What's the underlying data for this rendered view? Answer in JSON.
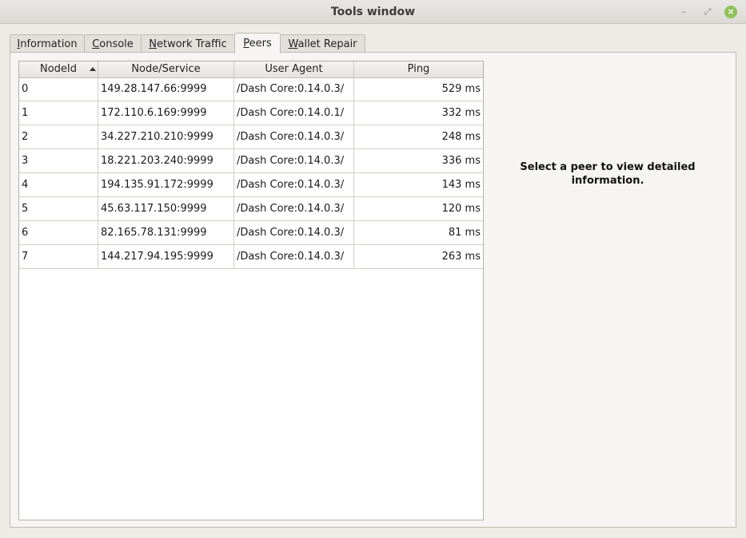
{
  "window": {
    "title": "Tools window",
    "minimize_glyph": "–",
    "restore_glyph": "⤢",
    "close_glyph": "×",
    "close_color": "#8fc25a"
  },
  "tabs": [
    {
      "label_mnemonic": "I",
      "label_rest": "nformation",
      "active": false
    },
    {
      "label_mnemonic": "C",
      "label_rest": "onsole",
      "active": false
    },
    {
      "label_mnemonic": "N",
      "label_rest": "etwork Traffic",
      "active": false
    },
    {
      "label_mnemonic": "P",
      "label_rest": "eers",
      "active": true
    },
    {
      "label_mnemonic": "W",
      "label_rest": "allet Repair",
      "active": false
    }
  ],
  "peers": {
    "columns": [
      "NodeId",
      "Node/Service",
      "User Agent",
      "Ping"
    ],
    "sort_column": "NodeId",
    "sort_order": "ascending",
    "rows": [
      {
        "id": "0",
        "service": "149.28.147.66:9999",
        "agent": "/Dash Core:0.14.0.3/",
        "ping": "529 ms"
      },
      {
        "id": "1",
        "service": "172.110.6.169:9999",
        "agent": "/Dash Core:0.14.0.1/",
        "ping": "332 ms"
      },
      {
        "id": "2",
        "service": "34.227.210.210:9999",
        "agent": "/Dash Core:0.14.0.3/",
        "ping": "248 ms"
      },
      {
        "id": "3",
        "service": "18.221.203.240:9999",
        "agent": "/Dash Core:0.14.0.3/",
        "ping": "336 ms"
      },
      {
        "id": "4",
        "service": "194.135.91.172:9999",
        "agent": "/Dash Core:0.14.0.3/",
        "ping": "143 ms"
      },
      {
        "id": "5",
        "service": "45.63.117.150:9999",
        "agent": "/Dash Core:0.14.0.3/",
        "ping": "120 ms"
      },
      {
        "id": "6",
        "service": "82.165.78.131:9999",
        "agent": "/Dash Core:0.14.0.3/",
        "ping": "81 ms"
      },
      {
        "id": "7",
        "service": "144.217.94.195:9999",
        "agent": "/Dash Core:0.14.0.3/",
        "ping": "263 ms"
      }
    ]
  },
  "detail": {
    "message": "Select a peer to view detailed information."
  }
}
